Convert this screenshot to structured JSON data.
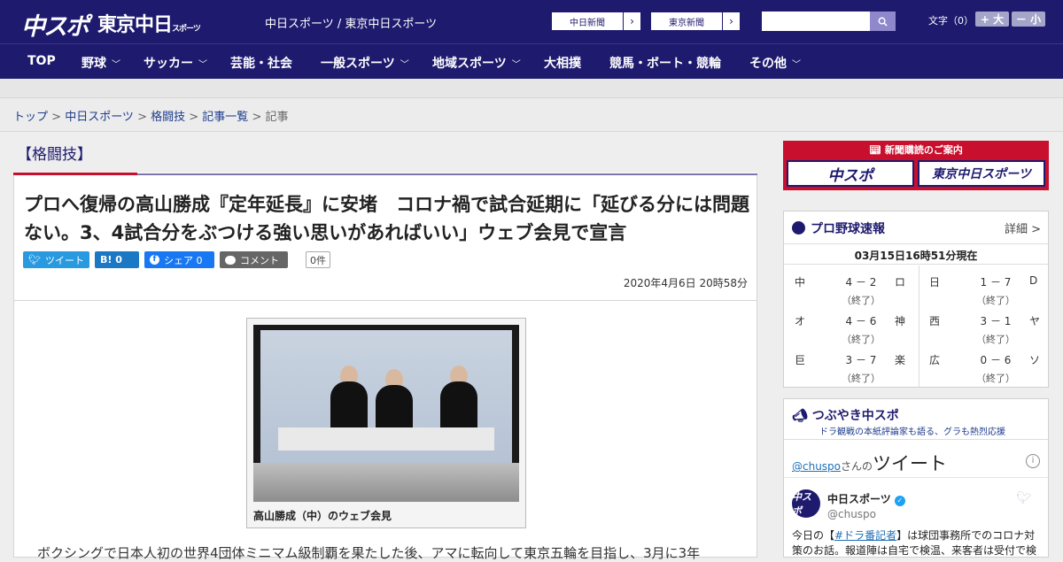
{
  "header": {
    "logo_primary": "中スポ",
    "logo_secondary": "東京中日",
    "logo_secondary_small": "スポーツ",
    "site_names": "中日スポーツ / 東京中日スポーツ",
    "link_chunichi": "中日新聞",
    "link_tokyo": "東京新聞",
    "font_size_label": "文字（0）",
    "font_plus": "+ 大",
    "font_minus": "－ 小"
  },
  "nav": {
    "items": [
      "TOP",
      "野球",
      "サッカー",
      "芸能・社会",
      "一般スポーツ",
      "地域スポーツ",
      "大相撲",
      "競馬・ボート・競輪",
      "その他"
    ]
  },
  "breadcrumb": {
    "items": [
      "トップ",
      "中日スポーツ",
      "格闘技",
      "記事一覧"
    ],
    "current": "記事"
  },
  "article": {
    "category": "【格闘技】",
    "headline": "プロへ復帰の高山勝成『定年延長』に安堵　コロナ禍で試合延期に「延びる分には問題ない。3、4試合分をぶつける強い思いがあればいい」ウェブ会見で宣言",
    "share": {
      "tweet": "ツイート",
      "hatena": "B! 0",
      "facebook": "シェア 0",
      "comment": "コメント",
      "comment_count": "0件"
    },
    "date": "2020年4月6日 20時58分",
    "photo_caption": "高山勝成（中）のウェブ会見",
    "body_first_line": "ボクシングで日本人初の世界4団体ミニマム級制覇を果たした後、アマに転向して東京五輪を目指し、3月に3年"
  },
  "sidebar": {
    "subscription": {
      "title": "新聞購読のご案内",
      "btn_a": "中スポ",
      "btn_b": "東京中日スポーツ"
    },
    "baseball": {
      "title": "プロ野球速報",
      "detail": "詳細 >",
      "time": "03月15日16時51分現在",
      "games": [
        {
          "home": "中",
          "score": "4 － 2",
          "away": "ロ",
          "status": "（終了）"
        },
        {
          "home": "日",
          "score": "1 － 7",
          "away": "D",
          "status": "（終了）"
        },
        {
          "home": "オ",
          "score": "4 － 6",
          "away": "神",
          "status": "（終了）"
        },
        {
          "home": "西",
          "score": "3 － 1",
          "away": "ヤ",
          "status": "（終了）"
        },
        {
          "home": "巨",
          "score": "3 － 7",
          "away": "楽",
          "status": "（終了）"
        },
        {
          "home": "広",
          "score": "0 － 6",
          "away": "ソ",
          "status": "（終了）"
        }
      ]
    },
    "tweets": {
      "title": "つぶやき中スポ",
      "subtitle": "ドラ観戦の本紙評論家も語る、グラも熱烈応援",
      "handle_link": "@chuspo",
      "handle_suffix": "さんの",
      "heading": "ツイート",
      "account_name": "中日スポーツ",
      "account_handle": "@chuspo",
      "avatar_text": "中スポ",
      "text_pre": "今日の【",
      "text_tag": "#ドラ番記者",
      "text_post": "】は球団事務所でのコロナ対策のお話。報道陣は自宅で検温、来客者は受付で検"
    }
  }
}
